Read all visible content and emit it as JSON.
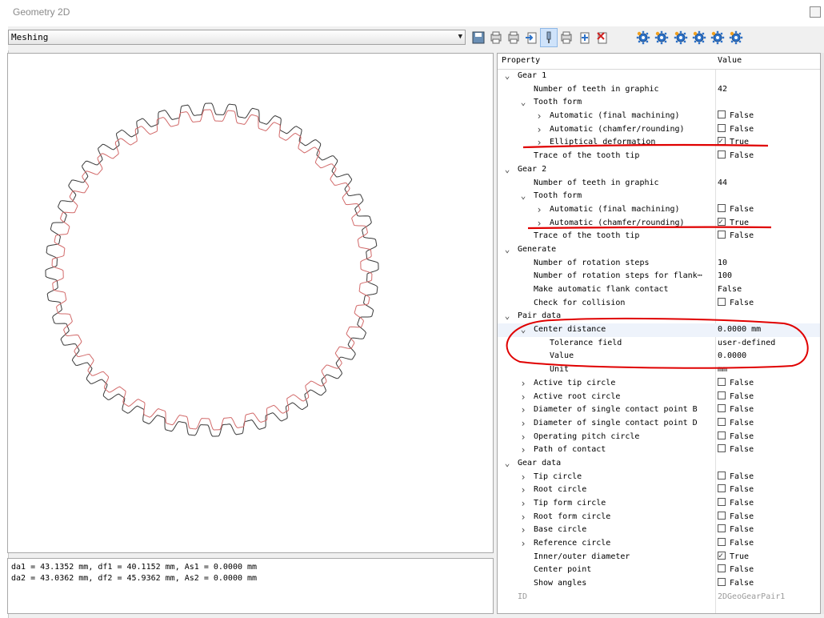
{
  "window": {
    "title": "Geometry 2D"
  },
  "toolbar": {
    "view_select": "Meshing",
    "buttons": [
      "save-icon",
      "print-icon",
      "print-preview-icon",
      "export-icon",
      "pin-icon",
      "clipboard-icon",
      "insert-icon",
      "delete-icon",
      "gear-tool-icon",
      "gear-tool-icon",
      "gear-tool-icon",
      "gear-tool-icon",
      "gear-tool-icon",
      "gear-tool-icon"
    ]
  },
  "grid": {
    "col_property": "Property",
    "col_value": "Value"
  },
  "rows": [
    {
      "indent": 0,
      "exp": "v",
      "label": "Gear 1",
      "type": "none",
      "value": ""
    },
    {
      "indent": 1,
      "exp": "",
      "label": "Number of teeth in graphic",
      "type": "text",
      "value": "42"
    },
    {
      "indent": 1,
      "exp": "v",
      "label": "Tooth form",
      "type": "none",
      "value": ""
    },
    {
      "indent": 2,
      "exp": ">",
      "label": "Automatic (final machining)",
      "type": "check",
      "checked": false,
      "value": "False"
    },
    {
      "indent": 2,
      "exp": ">",
      "label": "Automatic (chamfer/rounding)",
      "type": "check",
      "checked": false,
      "value": "False"
    },
    {
      "indent": 2,
      "exp": ">",
      "label": "Elliptical deformation",
      "type": "check",
      "checked": true,
      "value": "True"
    },
    {
      "indent": 1,
      "exp": "",
      "label": "Trace of the tooth tip",
      "type": "check",
      "checked": false,
      "value": "False"
    },
    {
      "indent": 0,
      "exp": "v",
      "label": "Gear 2",
      "type": "none",
      "value": ""
    },
    {
      "indent": 1,
      "exp": "",
      "label": "Number of teeth in graphic",
      "type": "text",
      "value": "44"
    },
    {
      "indent": 1,
      "exp": "v",
      "label": "Tooth form",
      "type": "none",
      "value": ""
    },
    {
      "indent": 2,
      "exp": ">",
      "label": "Automatic (final machining)",
      "type": "check",
      "checked": false,
      "value": "False"
    },
    {
      "indent": 2,
      "exp": ">",
      "label": "Automatic (chamfer/rounding)",
      "type": "check",
      "checked": true,
      "value": "True"
    },
    {
      "indent": 1,
      "exp": "",
      "label": "Trace of the tooth tip",
      "type": "check",
      "checked": false,
      "value": "False"
    },
    {
      "indent": 0,
      "exp": "v",
      "label": "Generate",
      "type": "none",
      "value": ""
    },
    {
      "indent": 1,
      "exp": "",
      "label": "Number of rotation steps",
      "type": "text",
      "value": "10"
    },
    {
      "indent": 1,
      "exp": "",
      "label": "Number of rotation steps for flank⋯",
      "type": "text",
      "value": "100"
    },
    {
      "indent": 1,
      "exp": "",
      "label": "Make automatic flank contact",
      "type": "text",
      "value": "False"
    },
    {
      "indent": 1,
      "exp": "",
      "label": "Check for collision",
      "type": "check",
      "checked": false,
      "value": "False"
    },
    {
      "indent": 0,
      "exp": "v",
      "label": "Pair data",
      "type": "none",
      "value": ""
    },
    {
      "indent": 1,
      "exp": "v",
      "label": "Center distance",
      "type": "text",
      "value": "0.0000 mm",
      "hl": true
    },
    {
      "indent": 2,
      "exp": "",
      "label": "Tolerance field",
      "type": "text",
      "value": "user-defined"
    },
    {
      "indent": 2,
      "exp": "",
      "label": "Value",
      "type": "text",
      "value": "0.0000"
    },
    {
      "indent": 2,
      "exp": "",
      "label": "Unit",
      "type": "text",
      "value": "mm"
    },
    {
      "indent": 1,
      "exp": ">",
      "label": "Active tip circle",
      "type": "check",
      "checked": false,
      "value": "False"
    },
    {
      "indent": 1,
      "exp": ">",
      "label": "Active root circle",
      "type": "check",
      "checked": false,
      "value": "False"
    },
    {
      "indent": 1,
      "exp": ">",
      "label": "Diameter of single contact point B",
      "type": "check",
      "checked": false,
      "value": "False"
    },
    {
      "indent": 1,
      "exp": ">",
      "label": "Diameter of single contact point D",
      "type": "check",
      "checked": false,
      "value": "False"
    },
    {
      "indent": 1,
      "exp": ">",
      "label": "Operating pitch circle",
      "type": "check",
      "checked": false,
      "value": "False"
    },
    {
      "indent": 1,
      "exp": ">",
      "label": "Path of contact",
      "type": "check",
      "checked": false,
      "value": "False"
    },
    {
      "indent": 0,
      "exp": "v",
      "label": "Gear data",
      "type": "none",
      "value": ""
    },
    {
      "indent": 1,
      "exp": ">",
      "label": "Tip circle",
      "type": "check",
      "checked": false,
      "value": "False"
    },
    {
      "indent": 1,
      "exp": ">",
      "label": "Root circle",
      "type": "check",
      "checked": false,
      "value": "False"
    },
    {
      "indent": 1,
      "exp": ">",
      "label": "Tip form circle",
      "type": "check",
      "checked": false,
      "value": "False"
    },
    {
      "indent": 1,
      "exp": ">",
      "label": "Root form circle",
      "type": "check",
      "checked": false,
      "value": "False"
    },
    {
      "indent": 1,
      "exp": ">",
      "label": "Base circle",
      "type": "check",
      "checked": false,
      "value": "False"
    },
    {
      "indent": 1,
      "exp": ">",
      "label": "Reference circle",
      "type": "check",
      "checked": false,
      "value": "False"
    },
    {
      "indent": 1,
      "exp": "",
      "label": "Inner/outer diameter",
      "type": "check",
      "checked": true,
      "value": "True"
    },
    {
      "indent": 1,
      "exp": "",
      "label": "Center point",
      "type": "check",
      "checked": false,
      "value": "False"
    },
    {
      "indent": 1,
      "exp": "",
      "label": "Show angles",
      "type": "check",
      "checked": false,
      "value": "False"
    },
    {
      "indent": 0,
      "exp": "",
      "label": "ID",
      "type": "text",
      "value": "2DGeoGearPair1",
      "grey": true
    }
  ],
  "status": {
    "line1": "da1 = 43.1352 mm, df1 = 40.1152 mm, As1 = 0.0000 mm",
    "line2": "da2 = 43.0362 mm, df2 = 45.9362 mm, As2 = 0.0000 mm"
  },
  "gears": {
    "outer_teeth": 44,
    "inner_teeth": 42,
    "outer_color": "#3a3a3a",
    "inner_color": "#d26a6a"
  },
  "colors": {
    "annotation": "#e00000",
    "selection": "#cfe3fa"
  }
}
